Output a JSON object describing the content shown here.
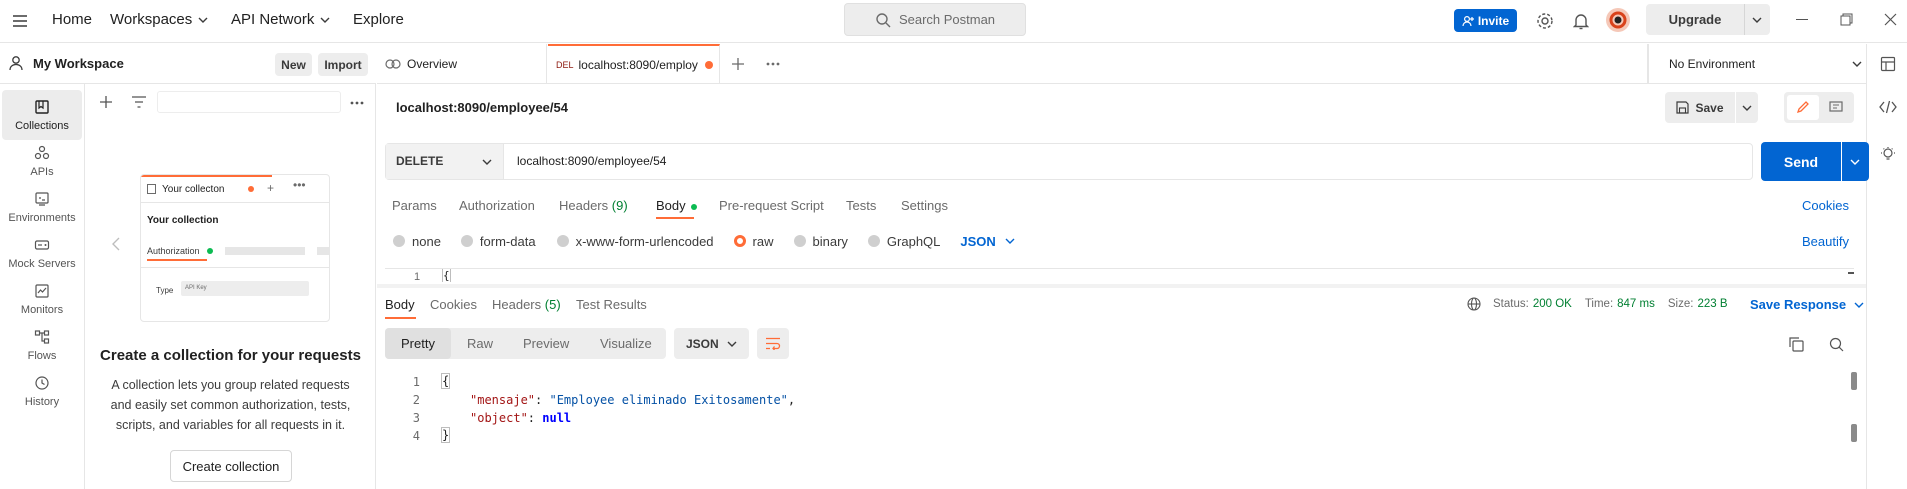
{
  "topbar": {
    "home": "Home",
    "workspaces": "Workspaces",
    "api_network": "API Network",
    "explore": "Explore",
    "search_placeholder": "Search Postman",
    "invite": "Invite",
    "upgrade": "Upgrade"
  },
  "workspace": {
    "name": "My Workspace",
    "new_label": "New",
    "import_label": "Import"
  },
  "rail": [
    {
      "label": "Collections",
      "icon": "collections-icon"
    },
    {
      "label": "APIs",
      "icon": "apis-icon"
    },
    {
      "label": "Environments",
      "icon": "environments-icon"
    },
    {
      "label": "Mock Servers",
      "icon": "mock-servers-icon"
    },
    {
      "label": "Monitors",
      "icon": "monitors-icon"
    },
    {
      "label": "Flows",
      "icon": "flows-icon"
    },
    {
      "label": "History",
      "icon": "history-icon"
    }
  ],
  "empty_state": {
    "preview_tab": "Your collecton",
    "preview_title": "Your collection",
    "preview_auth": "Authorization",
    "preview_type": "Type",
    "preview_type_value": "API Key",
    "heading": "Create a collection for your requests",
    "body": "A collection lets you group related requests and easily set common authorization, tests, scripts, and variables for all requests in it.",
    "button": "Create collection"
  },
  "tabs": {
    "overview": "Overview",
    "active_method": "DEL",
    "active_title": "localhost:8090/employ"
  },
  "environment": "No Environment",
  "request": {
    "name": "localhost:8090/employee/54",
    "save": "Save",
    "method": "DELETE",
    "url": "localhost:8090/employee/54",
    "send": "Send"
  },
  "request_tabs": {
    "params": "Params",
    "authorization": "Authorization",
    "headers": "Headers",
    "headers_count": "(9)",
    "body": "Body",
    "pre_request": "Pre-request Script",
    "tests": "Tests",
    "settings": "Settings",
    "cookies": "Cookies"
  },
  "body_types": {
    "none": "none",
    "form_data": "form-data",
    "urlencoded": "x-www-form-urlencoded",
    "raw": "raw",
    "binary": "binary",
    "graphql": "GraphQL",
    "format": "JSON",
    "beautify": "Beautify"
  },
  "request_editor": {
    "line": "1",
    "text": "{"
  },
  "response": {
    "tabs": {
      "body": "Body",
      "cookies": "Cookies",
      "headers": "Headers",
      "headers_count": "(5)",
      "test_results": "Test Results"
    },
    "status_label": "Status:",
    "status_value": "200 OK",
    "time_label": "Time:",
    "time_value": "847 ms",
    "size_label": "Size:",
    "size_value": "223 B",
    "save_response": "Save Response",
    "views": {
      "pretty": "Pretty",
      "raw": "Raw",
      "preview": "Preview",
      "visualize": "Visualize"
    },
    "format": "JSON",
    "lines": [
      "1",
      "2",
      "3",
      "4"
    ],
    "code": {
      "open": "{",
      "key1": "\"mensaje\"",
      "val1": "\"Employee eliminado Exitosamente\"",
      "key2": "\"object\"",
      "val2": "null",
      "close": "}"
    }
  },
  "colors": {
    "accent": "#ff6c37",
    "primary": "#0265d2",
    "status_ok": "#007f31",
    "json_key": "#a31515",
    "json_string": "#0451a5",
    "json_null": "#0000ff"
  }
}
